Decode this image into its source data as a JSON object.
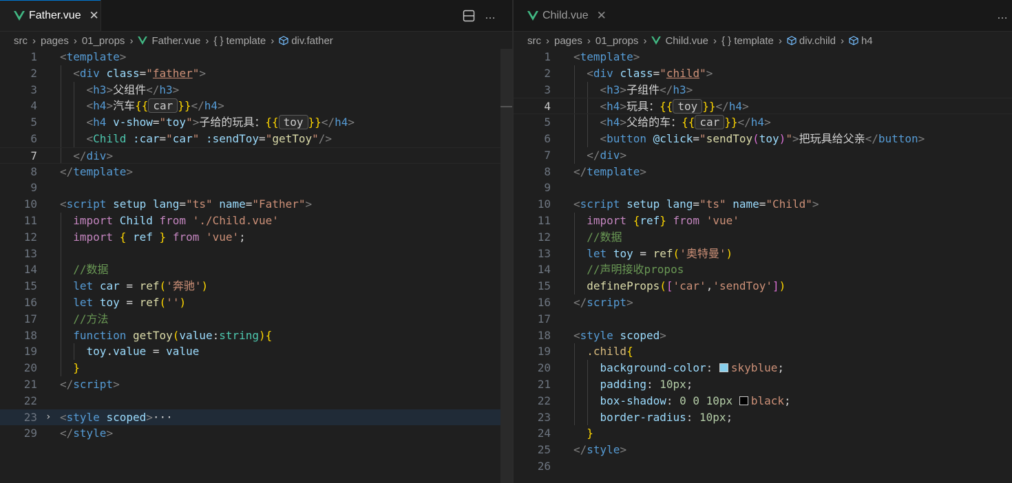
{
  "left": {
    "tab": {
      "label": "Father.vue",
      "close": "✕"
    },
    "toolbar": {
      "split": "split-editor-icon",
      "more": "…"
    },
    "breadcrumb": [
      "src",
      "pages",
      "01_props",
      "Father.vue",
      "{ } template",
      "div.father"
    ],
    "active_line": "7",
    "lines": [
      {
        "n": "1"
      },
      {
        "n": "2"
      },
      {
        "n": "3"
      },
      {
        "n": "4"
      },
      {
        "n": "5"
      },
      {
        "n": "6"
      },
      {
        "n": "7"
      },
      {
        "n": "8"
      },
      {
        "n": "9"
      },
      {
        "n": "10"
      },
      {
        "n": "11"
      },
      {
        "n": "12"
      },
      {
        "n": "13"
      },
      {
        "n": "14"
      },
      {
        "n": "15"
      },
      {
        "n": "16"
      },
      {
        "n": "17"
      },
      {
        "n": "18"
      },
      {
        "n": "19"
      },
      {
        "n": "20"
      },
      {
        "n": "21"
      },
      {
        "n": "22"
      },
      {
        "n": "23"
      },
      {
        "n": "29"
      }
    ]
  },
  "right": {
    "tab": {
      "label": "Child.vue",
      "close": "✕"
    },
    "toolbar": {
      "more": "…"
    },
    "breadcrumb": [
      "src",
      "pages",
      "01_props",
      "Child.vue",
      "{ } template",
      "div.child",
      "h4"
    ],
    "active_line": "4",
    "lines": [
      {
        "n": "1"
      },
      {
        "n": "2"
      },
      {
        "n": "3"
      },
      {
        "n": "4"
      },
      {
        "n": "5"
      },
      {
        "n": "6"
      },
      {
        "n": "7"
      },
      {
        "n": "8"
      },
      {
        "n": "9"
      },
      {
        "n": "10"
      },
      {
        "n": "11"
      },
      {
        "n": "12"
      },
      {
        "n": "13"
      },
      {
        "n": "14"
      },
      {
        "n": "15"
      },
      {
        "n": "16"
      },
      {
        "n": "17"
      },
      {
        "n": "18"
      },
      {
        "n": "19"
      },
      {
        "n": "20"
      },
      {
        "n": "21"
      },
      {
        "n": "22"
      },
      {
        "n": "23"
      },
      {
        "n": "24"
      },
      {
        "n": "25"
      },
      {
        "n": "26"
      }
    ]
  },
  "colors": {
    "vue_green": "#41b883",
    "swatch_skyblue": "#87ceeb",
    "swatch_black": "#000000",
    "accent": "#0078d4"
  }
}
